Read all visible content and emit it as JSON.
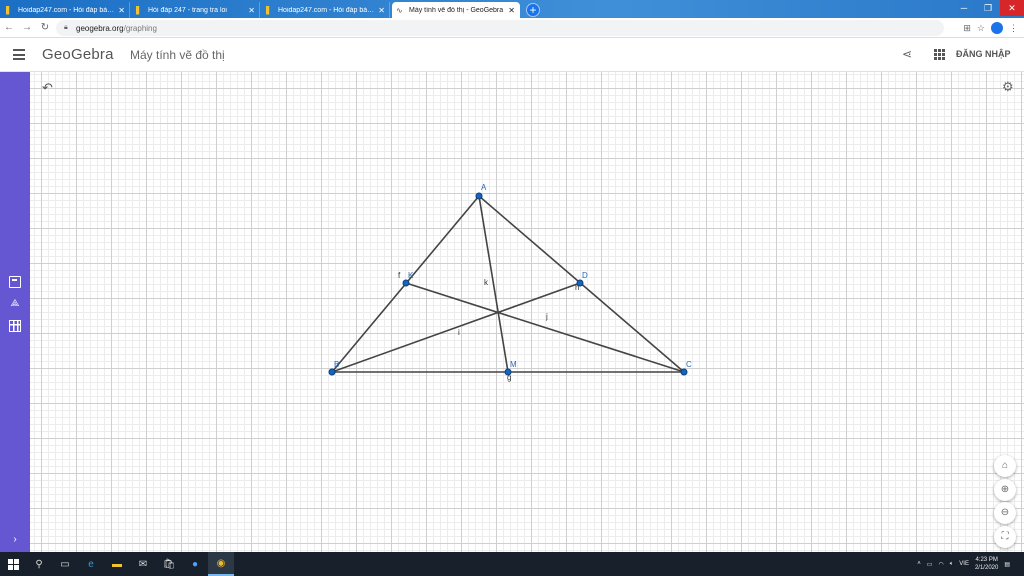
{
  "browser": {
    "tabs": [
      {
        "title": "Hoidap247.com - Hỏi đáp bài tập",
        "icon": "hoidap247-favicon"
      },
      {
        "title": "Hỏi đáp 247 - trang tra loi",
        "icon": "hoidap247-favicon"
      },
      {
        "title": "Hoidap247.com - Hỏi đáp bài tập",
        "icon": "hoidap247-favicon"
      },
      {
        "title": "Máy tính vẽ đồ thị - GeoGebra",
        "icon": "geogebra-favicon"
      }
    ],
    "active_tab": 3,
    "url_domain": "geogebra.org",
    "url_path": "/graphing"
  },
  "app": {
    "logo": "GeoGebra",
    "title": "Máy tính vẽ đồ thị",
    "login_label": "ĐĂNG NHẬP"
  },
  "construction": {
    "points": [
      {
        "name": "A"
      },
      {
        "name": "B"
      },
      {
        "name": "C"
      },
      {
        "name": "K"
      },
      {
        "name": "D"
      },
      {
        "name": "M"
      }
    ],
    "segment_labels": [
      "f",
      "h",
      "k",
      "j",
      "i",
      "g"
    ]
  },
  "taskbar": {
    "language": "VIE",
    "time": "4:23 PM",
    "date": "2/1/2020"
  },
  "colors": {
    "toolbar": "#6557d2",
    "point": "#1565c0",
    "segment": "#444444"
  }
}
